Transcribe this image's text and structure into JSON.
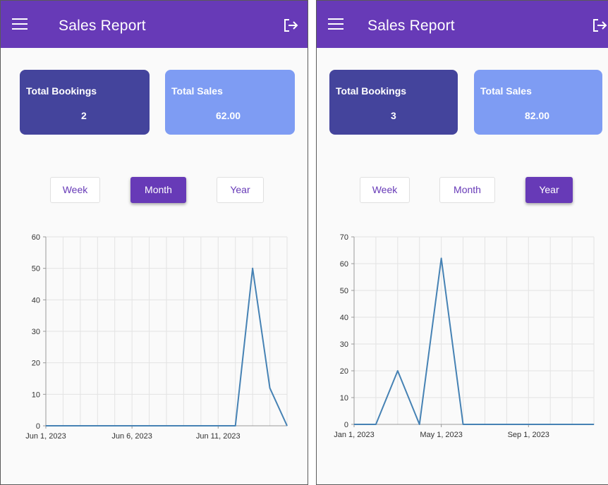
{
  "screens": [
    {
      "app_title": "Sales Report",
      "menu_icon": "hamburger-menu-icon",
      "logout_icon": "logout-icon",
      "cards": [
        {
          "label": "Total Bookings",
          "value": "2",
          "color": "#44449c"
        },
        {
          "label": "Total Sales",
          "value": "62.00",
          "color": "#7e9cf3"
        }
      ],
      "ranges": [
        "Week",
        "Month",
        "Year"
      ],
      "selected_range": "Month"
    },
    {
      "app_title": "Sales Report",
      "menu_icon": "hamburger-menu-icon",
      "logout_icon": "logout-icon",
      "cards": [
        {
          "label": "Total Bookings",
          "value": "3",
          "color": "#44449c"
        },
        {
          "label": "Total Sales",
          "value": "82.00",
          "color": "#7e9cf3"
        }
      ],
      "ranges": [
        "Week",
        "Month",
        "Year"
      ],
      "selected_range": "Year"
    }
  ],
  "chart_data": [
    {
      "type": "line",
      "ylim": [
        0,
        60
      ],
      "y_ticks": [
        0,
        10,
        20,
        30,
        40,
        50,
        60
      ],
      "x_ticks": [
        "Jun 1, 2023",
        "Jun 6, 2023",
        "Jun 11, 2023"
      ],
      "x_range_days": [
        0,
        14
      ],
      "x": [
        "Jun 1, 2023",
        "Jun 12, 2023",
        "Jun 13, 2023",
        "Jun 14, 2023",
        "Jun 15, 2023"
      ],
      "x_days": [
        0,
        11,
        12,
        13,
        14
      ],
      "y": [
        0,
        0,
        50,
        12,
        0
      ],
      "grid": true,
      "line_color": "#4682b4"
    },
    {
      "type": "line",
      "ylim": [
        0,
        70
      ],
      "y_ticks": [
        0,
        10,
        20,
        30,
        40,
        50,
        60,
        70
      ],
      "x_ticks": [
        "Jan 1, 2023",
        "May 1, 2023",
        "Sep 1, 2023"
      ],
      "x_range_months": [
        0,
        11
      ],
      "x": [
        "Jan 2023",
        "Feb 2023",
        "Mar 2023",
        "Apr 2023",
        "May 2023",
        "Jun 2023",
        "Jul 2023",
        "Aug 2023",
        "Sep 2023",
        "Oct 2023",
        "Nov 2023",
        "Dec 2023"
      ],
      "y": [
        0,
        0,
        20,
        0,
        62,
        0,
        0,
        0,
        0,
        0,
        0,
        0
      ],
      "grid": true,
      "line_color": "#4682b4"
    }
  ]
}
